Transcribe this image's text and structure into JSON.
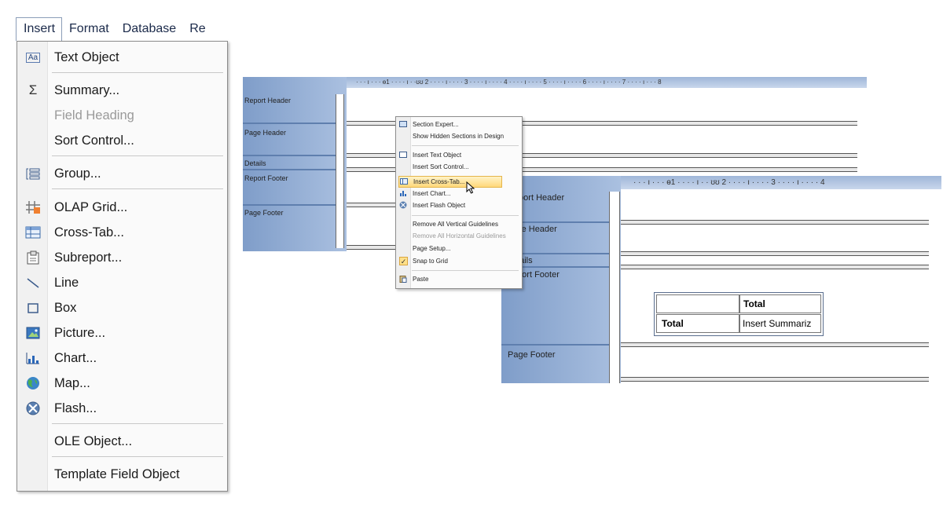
{
  "menubar": {
    "items": [
      "Insert",
      "Format",
      "Database",
      "Re"
    ]
  },
  "insert_menu": {
    "items": [
      {
        "icon": "text-object-icon",
        "label": "Text Object",
        "enabled": true
      },
      {
        "icon": "summary-icon",
        "label": "Summary...",
        "enabled": true
      },
      {
        "icon": "",
        "label": "Field Heading",
        "enabled": false
      },
      {
        "icon": "",
        "label": "Sort Control...",
        "enabled": true
      },
      {
        "icon": "group-icon",
        "label": "Group...",
        "enabled": true
      },
      {
        "icon": "olap-grid-icon",
        "label": "OLAP Grid...",
        "enabled": true
      },
      {
        "icon": "cross-tab-icon",
        "label": "Cross-Tab...",
        "enabled": true
      },
      {
        "icon": "subreport-icon",
        "label": "Subreport...",
        "enabled": true
      },
      {
        "icon": "line-icon",
        "label": "Line",
        "enabled": true
      },
      {
        "icon": "box-icon",
        "label": "Box",
        "enabled": true
      },
      {
        "icon": "picture-icon",
        "label": "Picture...",
        "enabled": true
      },
      {
        "icon": "chart-icon",
        "label": "Chart...",
        "enabled": true
      },
      {
        "icon": "map-icon",
        "label": "Map...",
        "enabled": true
      },
      {
        "icon": "flash-icon",
        "label": "Flash...",
        "enabled": true
      },
      {
        "icon": "",
        "label": "OLE Object...",
        "enabled": true
      },
      {
        "icon": "",
        "label": "Template Field Object",
        "enabled": true
      }
    ]
  },
  "designer_back": {
    "sections": [
      "Report Header",
      "Page Header",
      "Details",
      "Report Footer",
      "Page Footer"
    ],
    "ruler": "· · · ı · · · ɵ1 · · · · ı · ·ʊʊ 2 · · · · ı · · · · 3 · · · · ı · · · · 4 · · · · ı · · · · 5 · · · · ı · · · · 6 · · · · ı · · · · 7 · · · · ı · · · 8"
  },
  "context_menu": {
    "items": [
      {
        "label": "Section Expert...",
        "icon": "section-expert-icon"
      },
      {
        "label": "Show Hidden Sections in Design",
        "icon": ""
      },
      {
        "label": "Insert Text Object",
        "icon": "text-object-icon"
      },
      {
        "label": "Insert Sort Control...",
        "icon": ""
      },
      {
        "label": "Insert Cross-Tab...",
        "icon": "cross-tab-icon",
        "highlighted": true
      },
      {
        "label": "Insert Chart...",
        "icon": "chart-icon"
      },
      {
        "label": "Insert Flash Object",
        "icon": "flash-icon"
      },
      {
        "label": "Remove All Vertical Guidelines",
        "icon": ""
      },
      {
        "label": "Remove All Horizontal Guidelines",
        "icon": "",
        "disabled": true
      },
      {
        "label": "Page Setup...",
        "icon": ""
      },
      {
        "label": "Snap to Grid",
        "icon": "check-icon"
      },
      {
        "label": "Paste",
        "icon": "paste-icon"
      }
    ]
  },
  "designer_front": {
    "sections": [
      "Report Header",
      "Page Header",
      "Details",
      "Report Footer",
      "Page Footer"
    ],
    "ruler": "· · · ı · · · ɵ1 · · · · ı · · ʊʊ 2 · · · · ı · · · · 3 · · · · ı · · · · 4"
  },
  "cross_tab": {
    "col_total": "Total",
    "row_total": "Total",
    "summary": "Insert Summariz"
  }
}
